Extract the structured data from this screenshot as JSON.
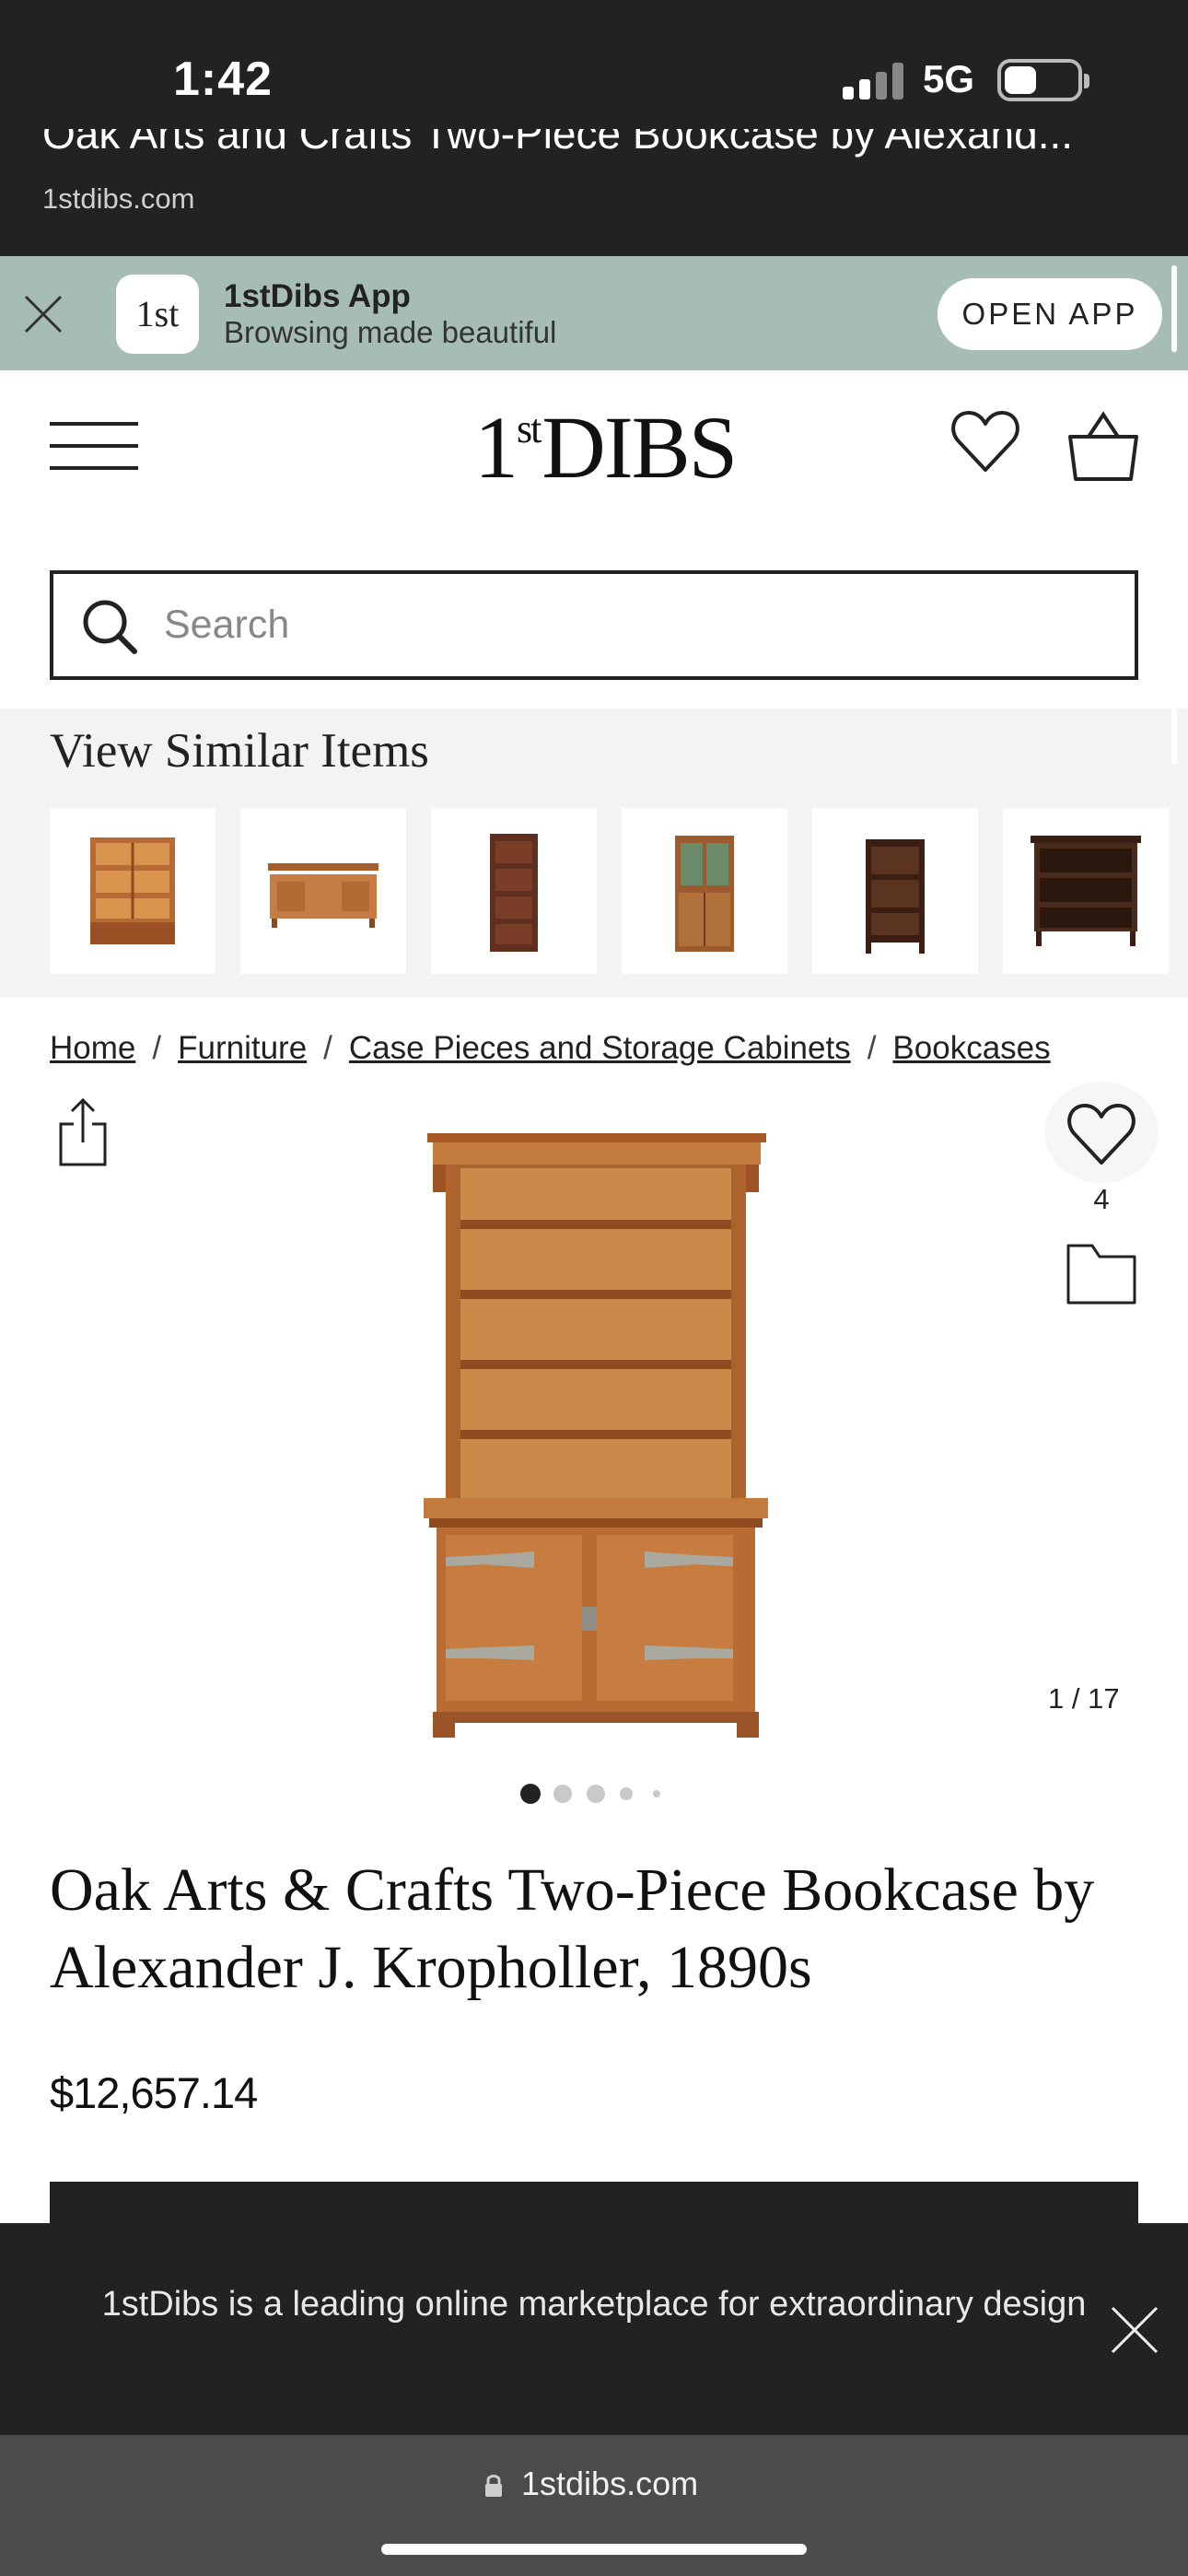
{
  "status_bar": {
    "time": "1:42",
    "network": "5G"
  },
  "browser_header": {
    "page_title": "Oak Arts and Crafts Two-Piece Bookcase by Alexand...",
    "domain": "1stdibs.com"
  },
  "app_banner": {
    "app_name": "1stDibs App",
    "tagline": "Browsing made beautiful",
    "button_label": "OPEN APP",
    "logo_text": "1st"
  },
  "header": {
    "logo_main": "1",
    "logo_sup": "st",
    "logo_rest": "DIBS",
    "icons": [
      "menu-icon",
      "heart-icon",
      "bag-icon"
    ]
  },
  "search": {
    "placeholder": "Search",
    "value": ""
  },
  "similar": {
    "title": "View Similar Items",
    "items": [
      "glass-front bookcase",
      "low sideboard",
      "tall stacking bookcase",
      "leaded glass cabinet",
      "open bookcase",
      "low bookcase"
    ]
  },
  "breadcrumb": [
    "Home",
    "Furniture",
    "Case Pieces and Storage Cabinets",
    "Bookcases"
  ],
  "breadcrumb_separator": "/",
  "product": {
    "title": "Oak Arts & Crafts Two-Piece Bookcase by Alexander J. Kropholler, 1890s",
    "price": "$12,657.14",
    "favorites_count": "4",
    "image_counter": "1 / 17",
    "carousel_active_index": 0,
    "carousel_dots": 5
  },
  "bottom_banner": {
    "text": "1stDibs is a leading online marketplace for extraordinary design"
  },
  "browser_bar": {
    "url": "1stdibs.com"
  },
  "colors": {
    "dark": "#222222",
    "banner": "#a6bdb6",
    "wood": "#b8692e",
    "section_bg": "#f3f3f3"
  }
}
